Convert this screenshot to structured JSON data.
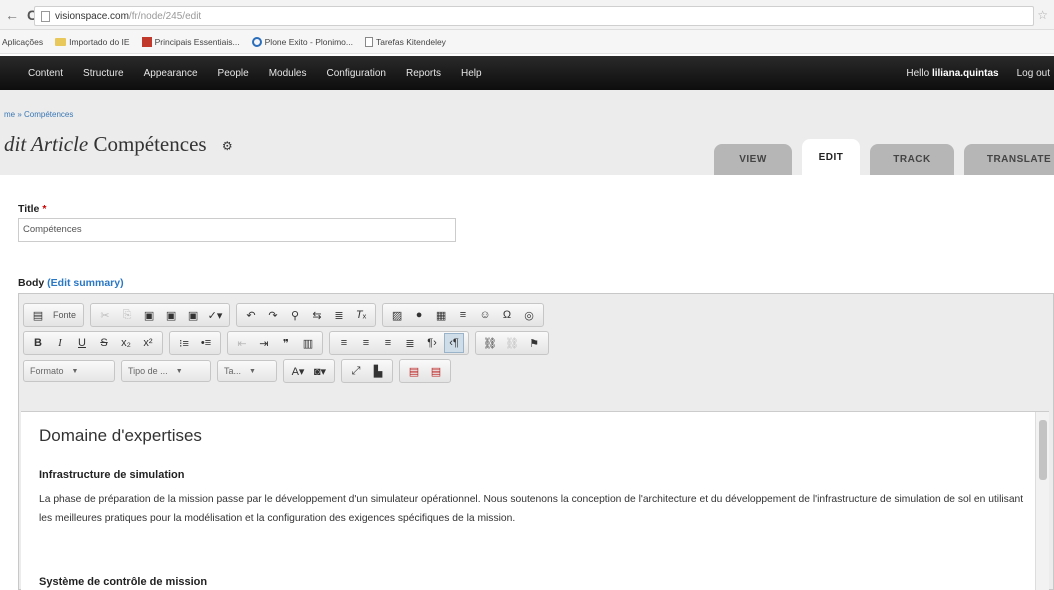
{
  "browser": {
    "nav_back": "←",
    "nav_reload": "C",
    "url_host": "visionspace.com",
    "url_path": "/fr/node/245/edit",
    "bookmarks": [
      {
        "label": "Aplicações",
        "icon": "none"
      },
      {
        "label": "Importado do IE",
        "icon": "folder"
      },
      {
        "label": "Principais Essentiais...",
        "icon": "red"
      },
      {
        "label": "Plone Exito - Plonimo...",
        "icon": "circle"
      },
      {
        "label": "Tarefas Kitendeley",
        "icon": "page"
      }
    ]
  },
  "admin_menu": {
    "items": [
      "Content",
      "Structure",
      "Appearance",
      "People",
      "Modules",
      "Configuration",
      "Reports",
      "Help"
    ],
    "hello_prefix": "Hello",
    "username": "liliana.quintas",
    "logout": "Log out"
  },
  "page": {
    "breadcrumb": "me » Compétences",
    "title_italic": "dit Article",
    "title_rest": "Compétences",
    "tabs": [
      {
        "label": "VIEW",
        "active": false
      },
      {
        "label": "EDIT",
        "active": true
      },
      {
        "label": "TRACK",
        "active": false
      },
      {
        "label": "TRANSLATE",
        "active": false
      }
    ]
  },
  "form": {
    "title_label": "Title",
    "required_mark": "*",
    "title_value": "Compétences",
    "body_label": "Body",
    "edit_summary": "(Edit summary)"
  },
  "editor": {
    "source_label": "Fonte",
    "combos": [
      "Formato",
      "Tipo de ...",
      "Ta..."
    ]
  },
  "content": {
    "heading": "Domaine d'expertises",
    "section1_title": "Infrastructure de simulation",
    "section1_text": "La phase de préparation de la mission passe par le développement d'un simulateur opérationnel. Nous soutenons la conception de l'architecture et du développement de l'infrastructure de simulation de sol en utilisant les meilleures pratiques pour la modélisation et la configuration des exigences spécifiques de la mission.",
    "section2_title": "Système de contrôle de mission"
  },
  "colors": {
    "admin_bar": "#111111",
    "link": "#2a77c4",
    "tab_inactive": "#b6b6b6"
  }
}
